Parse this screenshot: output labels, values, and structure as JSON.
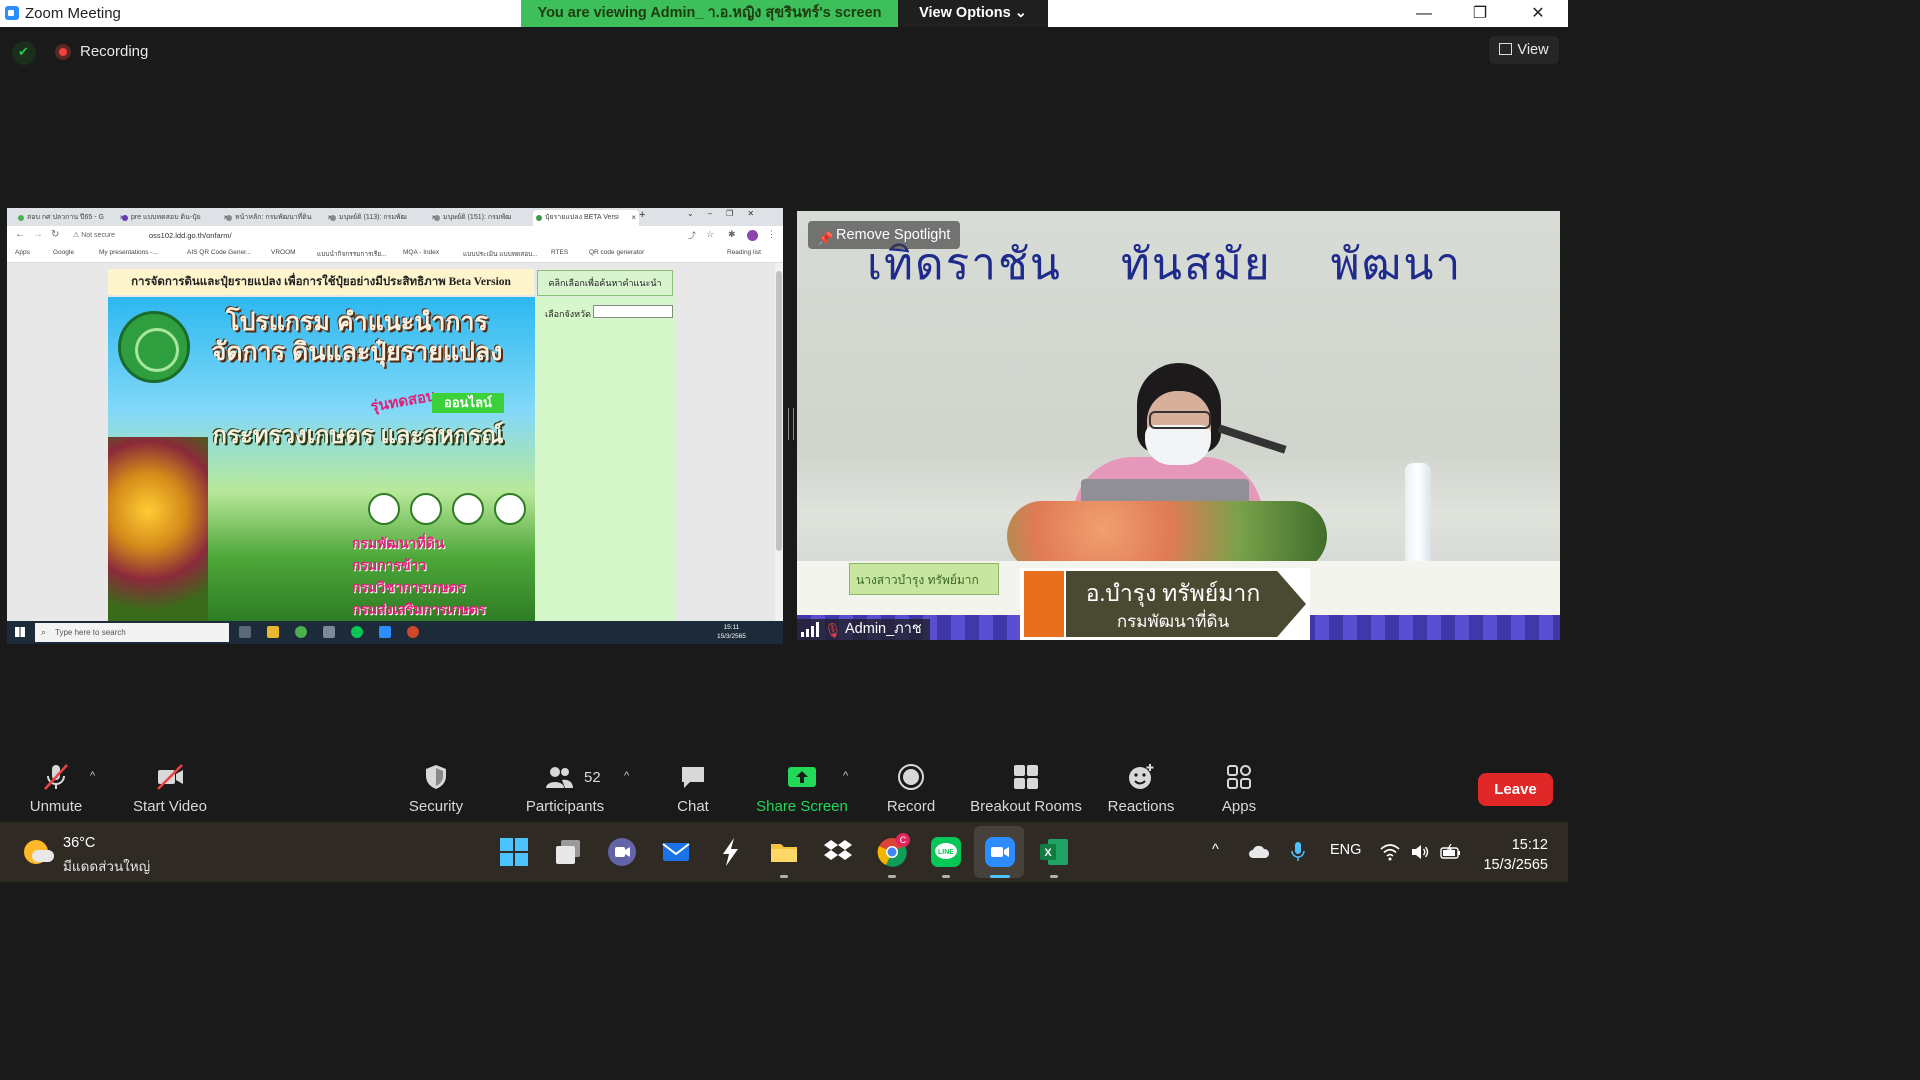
{
  "titlebar": {
    "app_title": "Zoom Meeting",
    "viewing_banner": "You are viewing Admin_ า.อ.หญิง สุขรินทร์'s screen",
    "view_options": "View Options ⌄",
    "minimize": "—",
    "restore": "❐",
    "close": "✕"
  },
  "meeting": {
    "recording_label": "Recording",
    "view_button": "View",
    "remove_spotlight": "Remove Spotlight",
    "participant_name": "Admin_ภาช"
  },
  "shared_screen": {
    "tabs": [
      {
        "label": "สอบ กศ ปลวกาน ปี65 - G"
      },
      {
        "label": "pre แบบทดสอบ ดิน-ปุ๋ย"
      },
      {
        "label": "หน้าหลัก: กรมพัฒนาที่ดิน"
      },
      {
        "label": "มนุษย์ดิ (113): กรมพัฒ"
      },
      {
        "label": "มนุษย์ดิ (151): กรมพัฒ"
      },
      {
        "label": "ปุ๋ยรายแปลง BETA Versi"
      }
    ],
    "new_tab": "+",
    "not_secure": "⚠ Not secure",
    "url": "oss102.ldd.go.th/onfarm/",
    "bookmarks": [
      "Apps",
      "Google",
      "My presentations -...",
      "AIS QR Code Gener...",
      "VROOM",
      "แบบนำกิจกรรมการเรีย...",
      "MQA - Index",
      "แบบประเมิน แบบทดสอบ...",
      "RTES",
      "QR code generator",
      "Reading list"
    ],
    "page_heading": "การจัดการดินและปุ๋ยรายแปลง เพื่อการใช้ปุ๋ยอย่างมีประสิทธิภาพ Beta Version",
    "find_button": "คลิกเลือกเพื่อค้นหาคำแนะนำ",
    "province_label": "เลือกจังหวัด",
    "banner_title": "โปรแกรม คำแนะนำการจัดการ ดินและปุ๋ยรายแปลง",
    "banner_tag_trial": "รุ่นทดสอบ",
    "banner_tag_online": "ออนไลน์",
    "banner_ministry": "กระทรวงเกษตร และสหกรณ์",
    "banner_departments": [
      "กรมพัฒนาที่ดิน",
      "กรมการข้าว",
      "กรมวิชาการเกษตร",
      "กรมส่งเสริมการเกษตร"
    ],
    "win_search": "Type here to search",
    "win_time": "15:11",
    "win_date": "15/3/2565"
  },
  "video": {
    "headline": "เทิดราชัน ทันสมัย พัฒนา",
    "nameplate": "นางสาวบำรุง ทรัพย์มาก",
    "caption_name": "อ.บำรุง ทรัพย์มาก",
    "caption_dept": "กรมพัฒนาที่ดิน"
  },
  "toolbar": {
    "unmute": "Unmute",
    "start_video": "Start Video",
    "security": "Security",
    "participants": "Participants",
    "participants_count": "52",
    "chat": "Chat",
    "share_screen": "Share Screen",
    "record": "Record",
    "breakout_rooms": "Breakout Rooms",
    "reactions": "Reactions",
    "apps": "Apps",
    "leave": "Leave",
    "caret": "^"
  },
  "taskbar": {
    "temperature": "36°C",
    "condition": "มีแดดส่วนใหญ่",
    "language": "ENG",
    "time": "15:12",
    "date": "15/3/2565",
    "chrome_badge": "C",
    "tray_caret": "^"
  },
  "colors": {
    "zoom_blue": "#2d8cff",
    "viewing_green": "#3dbf5b",
    "leave_red": "#e02828",
    "share_green": "#23d959",
    "mute_red": "#f04141"
  }
}
